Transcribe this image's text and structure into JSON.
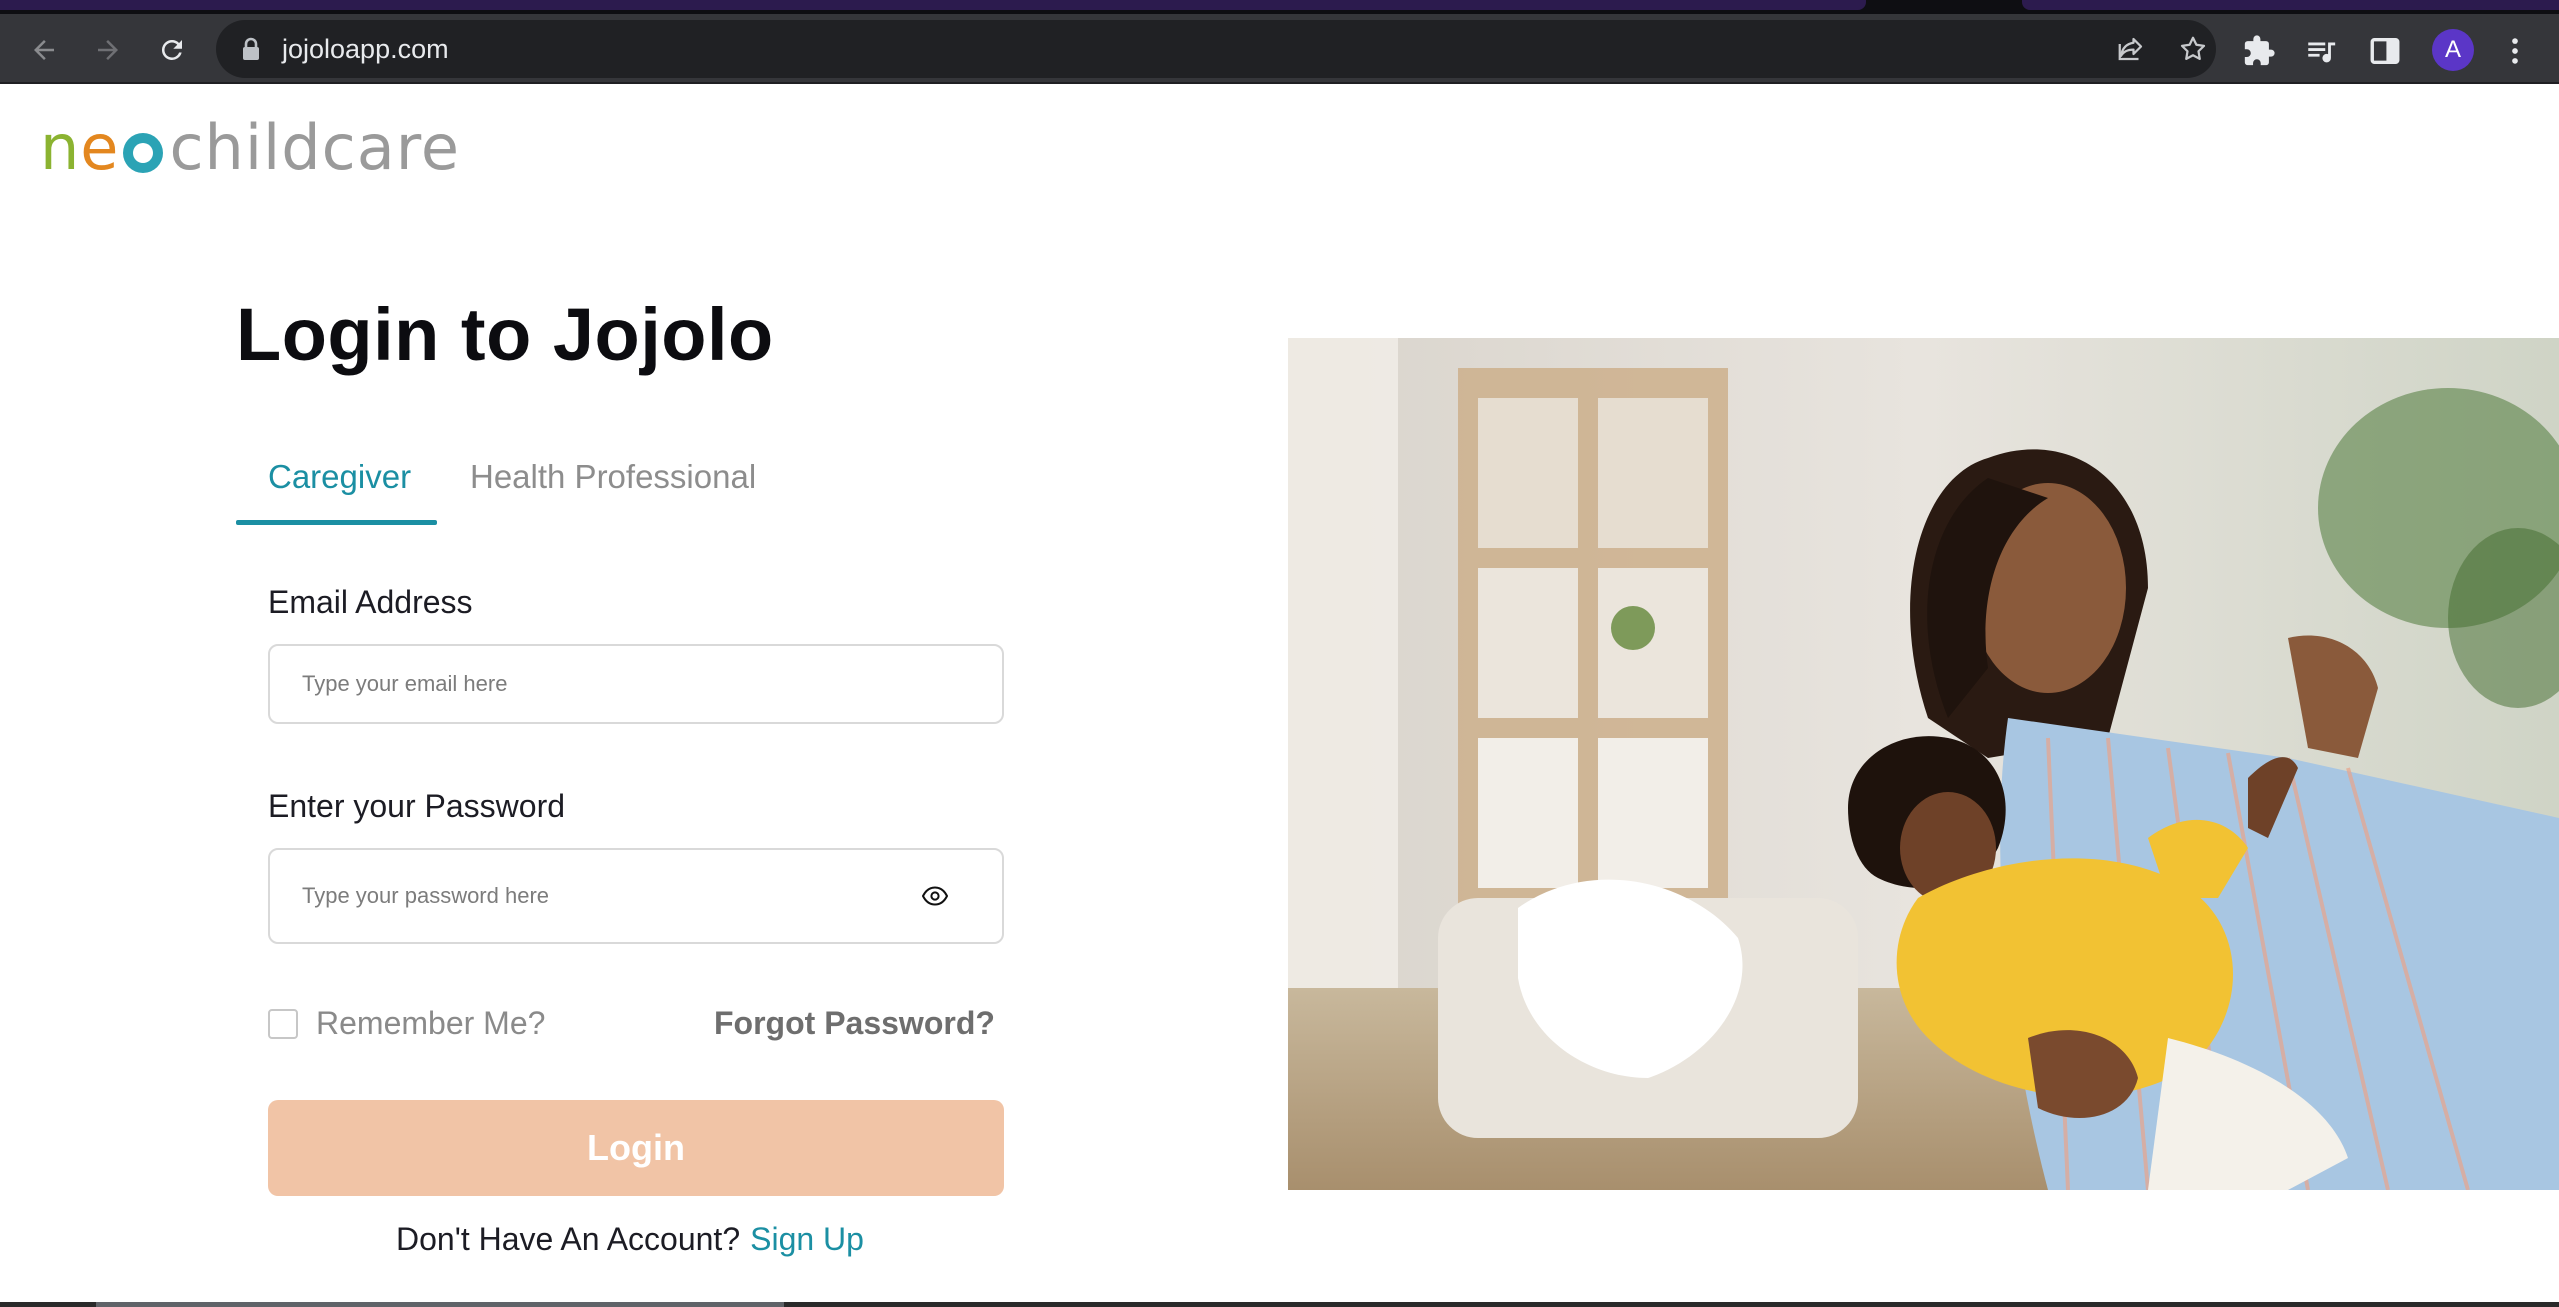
{
  "browser": {
    "url": "jojoloapp.com",
    "profile_initial": "A",
    "icons": [
      "back-icon",
      "forward-icon",
      "reload-icon",
      "lock-icon",
      "share-icon",
      "star-icon",
      "puzzle-icon",
      "media-icon",
      "sidepanel-icon",
      "menu-icon"
    ]
  },
  "logo": {
    "n": "n",
    "e": "e",
    "childcare": "childcare"
  },
  "page": {
    "title": "Login to Jojolo",
    "tabs": [
      {
        "label": "Caregiver",
        "active": true
      },
      {
        "label": "Health Professional",
        "active": false
      }
    ],
    "email": {
      "label": "Email Address",
      "placeholder": "Type your email here",
      "value": ""
    },
    "password": {
      "label": "Enter your Password",
      "placeholder": "Type your password here",
      "value": ""
    },
    "remember_label": "Remember Me?",
    "remember_checked": false,
    "forgot_label": "Forgot Password?",
    "login_label": "Login",
    "signup_prompt": "Don't Have An Account?",
    "signup_link": "Sign Up"
  },
  "colors": {
    "accent": "#1b8fa3",
    "login_button": "#f1c4a6",
    "logo_green": "#8bb331",
    "logo_orange": "#e3871f",
    "logo_grey": "#9a9a9a"
  }
}
